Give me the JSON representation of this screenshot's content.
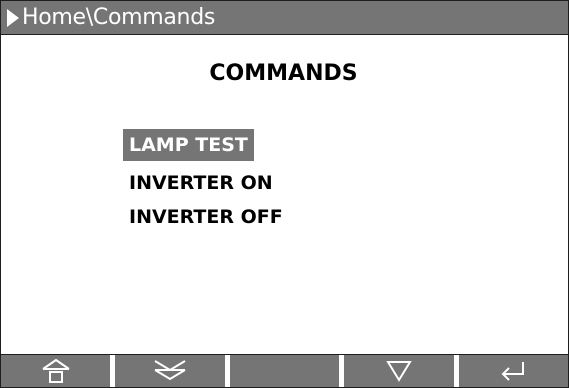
{
  "breadcrumb": {
    "path": "Home\\Commands"
  },
  "page": {
    "title": "COMMANDS"
  },
  "menu": {
    "items": [
      {
        "label": "LAMP TEST",
        "selected": true
      },
      {
        "label": "INVERTER ON",
        "selected": false
      },
      {
        "label": "INVERTER OFF",
        "selected": false
      }
    ]
  },
  "softkeys": [
    {
      "icon": "home-icon"
    },
    {
      "icon": "page-down-icon"
    },
    {
      "icon": ""
    },
    {
      "icon": "down-arrow-icon"
    },
    {
      "icon": "enter-icon"
    }
  ],
  "colors": {
    "bar": "#757575",
    "selection": "#757575",
    "text": "#000000",
    "bar_text": "#ffffff"
  }
}
